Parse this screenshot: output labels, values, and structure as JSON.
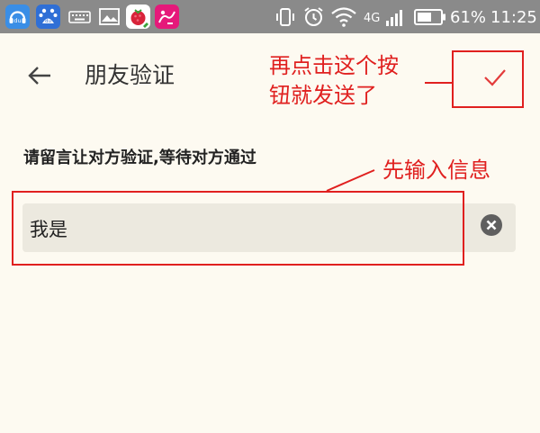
{
  "status_bar": {
    "network": "4G",
    "battery_percent": "61%",
    "time": "11:25",
    "app_icons": [
      "baidu-music-icon",
      "baidu-app-icon",
      "keyboard-icon",
      "gallery-icon",
      "raspberry-app-icon",
      "pink-app-icon"
    ],
    "system_icons": [
      "vibrate-icon",
      "alarm-icon",
      "wifi-icon",
      "signal-icon",
      "battery-icon"
    ]
  },
  "header": {
    "title": "朋友验证"
  },
  "instruction": "请留言让对方验证,等待对方通过",
  "message_input": {
    "value": "我是"
  },
  "annotations": {
    "send_hint": "再点击这个按钮就发送了",
    "send_hint_line1": "再点击这个按",
    "send_hint_line2": "钮就发送了",
    "input_hint": "先输入信息",
    "color": "#e0201f"
  },
  "colors": {
    "status_bar": "#8a8a8a",
    "background": "#fdfaf1",
    "input_background": "#ece9df",
    "accent": "#e0201f"
  }
}
